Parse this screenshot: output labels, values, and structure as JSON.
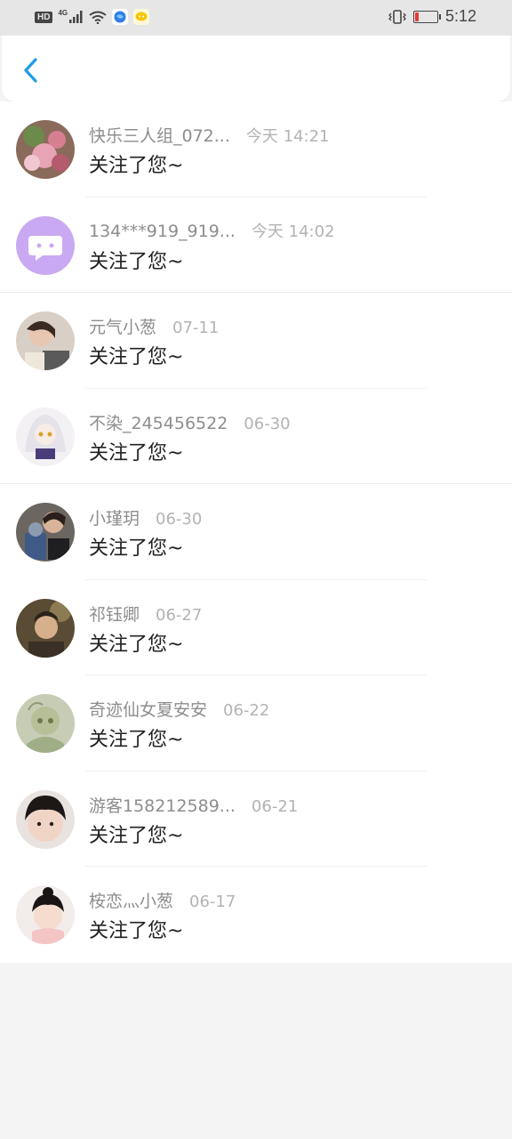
{
  "status_bar": {
    "hd": "HD",
    "network": "4G",
    "time": "5:12",
    "battery_level": 0.15
  },
  "header": {
    "back_icon": "chevron-left-icon",
    "accent": "#1e9be8"
  },
  "notifications": [
    {
      "name": "快乐三人组_072...",
      "time": "今天 14:21",
      "message": "关注了您~"
    },
    {
      "name": "134***919_919...",
      "time": "今天 14:02",
      "message": "关注了您~"
    },
    {
      "name": "元气小葱",
      "time": "07-11",
      "message": "关注了您~"
    },
    {
      "name": "不染_245456522",
      "time": "06-30",
      "message": "关注了您~"
    },
    {
      "name": "小瑾玥",
      "time": "06-30",
      "message": "关注了您~"
    },
    {
      "name": "祁钰卿",
      "time": "06-27",
      "message": "关注了您~"
    },
    {
      "name": "奇迹仙女夏安安",
      "time": "06-22",
      "message": "关注了您~"
    },
    {
      "name": "游客158212589...",
      "time": "06-21",
      "message": "关注了您~"
    },
    {
      "name": "桉恋灬小葱",
      "time": "06-17",
      "message": "关注了您~"
    }
  ]
}
